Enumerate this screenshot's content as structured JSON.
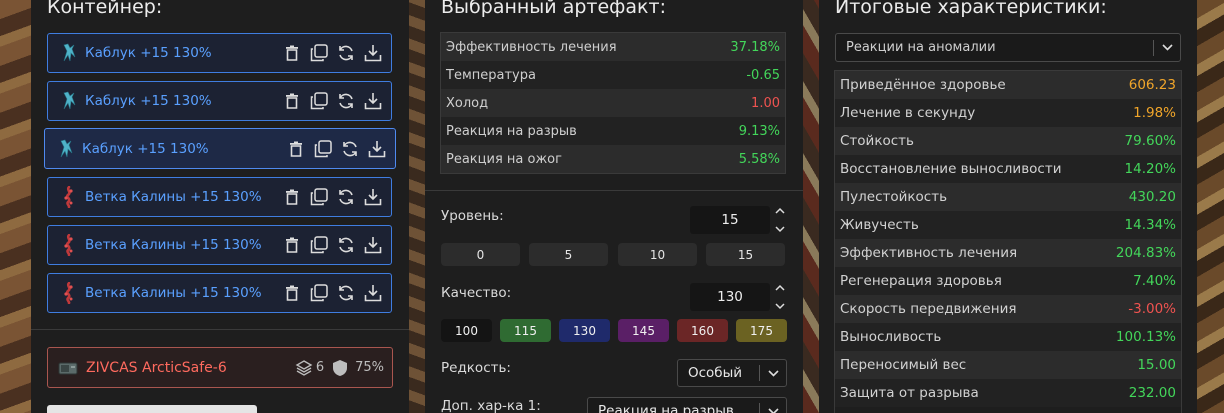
{
  "container": {
    "title": "Контейнер:",
    "items": [
      {
        "label": "Каблук +15 130%",
        "kind": "heel"
      },
      {
        "label": "Каблук +15 130%",
        "kind": "heel"
      },
      {
        "label": "Каблук +15 130%",
        "kind": "heel",
        "selected": true
      },
      {
        "label": "Ветка Калины +15 130%",
        "kind": "branch"
      },
      {
        "label": "Ветка Калины +15 130%",
        "kind": "branch"
      },
      {
        "label": "Ветка Калины +15 130%",
        "kind": "branch"
      }
    ],
    "safe": {
      "label": "ZIVCAS ArcticSafe-6",
      "slots": "6",
      "protection": "75%"
    }
  },
  "artifact": {
    "title": "Выбранный артефакт:",
    "stats": [
      {
        "name": "Эффективность лечения",
        "value": "37.18%",
        "tone": "green"
      },
      {
        "name": "Температура",
        "value": "-0.65",
        "tone": "green"
      },
      {
        "name": "Холод",
        "value": "1.00",
        "tone": "red"
      },
      {
        "name": "Реакция на разрыв",
        "value": "9.13%",
        "tone": "green"
      },
      {
        "name": "Реакция на ожог",
        "value": "5.58%",
        "tone": "green"
      }
    ],
    "level_label": "Уровень:",
    "level_value": "15",
    "level_presets": [
      "0",
      "5",
      "10",
      "15"
    ],
    "quality_label": "Качество:",
    "quality_value": "130",
    "quality_presets": [
      {
        "label": "100",
        "color": "#141414"
      },
      {
        "label": "115",
        "color": "#2f6b32"
      },
      {
        "label": "130",
        "color": "#1f2a6b"
      },
      {
        "label": "145",
        "color": "#5a1f66"
      },
      {
        "label": "160",
        "color": "#6b2626"
      },
      {
        "label": "175",
        "color": "#6b6222"
      }
    ],
    "rarity_label": "Редкость:",
    "rarity_value": "Особый",
    "extra1_label": "Доп. хар-ка 1:",
    "extra1_value": "Реакция на разрыв"
  },
  "totals": {
    "title": "Итоговые характеристики:",
    "filter_value": "Реакции на аномалии",
    "rows": [
      {
        "name": "Приведённое здоровье",
        "value": "606.23",
        "tone": "orange"
      },
      {
        "name": "Лечение в секунду",
        "value": "1.98%",
        "tone": "orange"
      },
      {
        "name": "Стойкость",
        "value": "79.60%",
        "tone": "green"
      },
      {
        "name": "Восстановление выносливости",
        "value": "14.20%",
        "tone": "green"
      },
      {
        "name": "Пулестойкость",
        "value": "430.20",
        "tone": "green"
      },
      {
        "name": "Живучесть",
        "value": "14.34%",
        "tone": "green"
      },
      {
        "name": "Эффективность лечения",
        "value": "204.83%",
        "tone": "green"
      },
      {
        "name": "Регенерация здоровья",
        "value": "7.40%",
        "tone": "green"
      },
      {
        "name": "Скорость передвижения",
        "value": "-3.00%",
        "tone": "red"
      },
      {
        "name": "Выносливость",
        "value": "100.13%",
        "tone": "green"
      },
      {
        "name": "Переносимый вес",
        "value": "15.00",
        "tone": "green"
      },
      {
        "name": "Защита от разрыва",
        "value": "232.00",
        "tone": "green"
      }
    ]
  }
}
